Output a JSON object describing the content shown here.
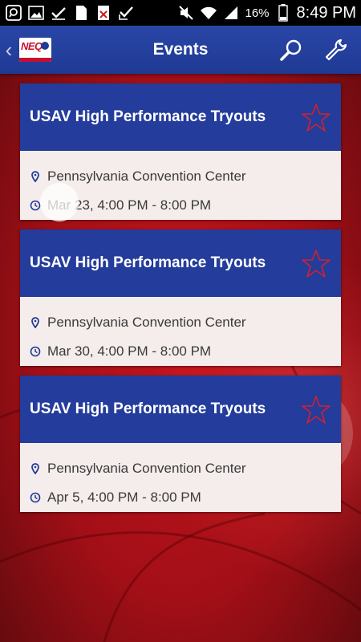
{
  "status_bar": {
    "battery_percent": "16%",
    "time": "8:49 PM",
    "left_icons": [
      "search-icon",
      "image-icon",
      "checkmark-icon",
      "sim-icon",
      "blocked-file-icon",
      "check-box-icon"
    ],
    "right_icons": [
      "mute-icon",
      "wifi-icon",
      "signal-icon",
      "battery-icon"
    ]
  },
  "app_bar": {
    "title": "Events",
    "logo_text": "NEQ",
    "actions": [
      "search-icon",
      "wrench-icon"
    ]
  },
  "events": [
    {
      "title": "USAV High Performance Tryouts",
      "location": "Pennsylvania Convention Center",
      "time": "Mar 23, 4:00 PM - 8:00 PM",
      "favorite": false
    },
    {
      "title": "USAV High Performance Tryouts",
      "location": "Pennsylvania Convention Center",
      "time": "Mar 30, 4:00 PM - 8:00 PM",
      "favorite": false
    },
    {
      "title": "USAV High Performance Tryouts",
      "location": "Pennsylvania Convention Center",
      "time": "Apr 5, 4:00 PM - 8:00 PM",
      "favorite": false
    }
  ],
  "colors": {
    "app_bar": "#1f3a94",
    "card_header": "#243c9b",
    "card_body": "#f5ecec",
    "star_outline": "#d0212f",
    "background": "#b5121b"
  }
}
